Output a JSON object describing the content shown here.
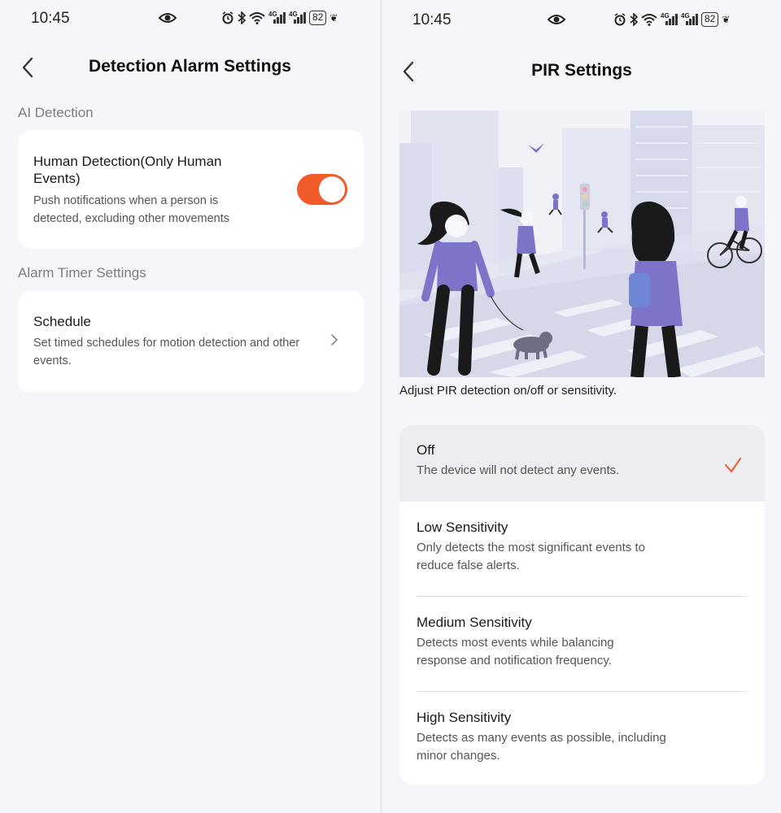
{
  "status_bar": {
    "time": "10:45",
    "network_label": "4G",
    "battery": "82"
  },
  "left_screen": {
    "title": "Detection Alarm Settings",
    "section_ai": "AI Detection",
    "human_detection": {
      "title": "Human Detection(Only Human Events)",
      "description": "Push notifications when a person is detected, excluding other movements",
      "enabled": true
    },
    "section_timer": "Alarm Timer Settings",
    "schedule": {
      "title": "Schedule",
      "description": "Set timed schedules for motion detection and other events."
    }
  },
  "right_screen": {
    "title": "PIR Settings",
    "caption": "Adjust PIR detection on/off or sensitivity.",
    "options": [
      {
        "title": "Off",
        "description": "The device will not detect any events.",
        "selected": true
      },
      {
        "title": "Low Sensitivity",
        "description": "Only detects the most significant events to reduce false alerts.",
        "selected": false
      },
      {
        "title": "Medium Sensitivity",
        "description": "Detects most events while balancing response and notification frequency.",
        "selected": false
      },
      {
        "title": "High Sensitivity",
        "description": "Detects as many events as possible, including minor changes.",
        "selected": false
      }
    ]
  },
  "colors": {
    "accent": "#f15a29",
    "background": "#f5f6f9",
    "card": "#ffffff",
    "selected_row": "#ecedf1",
    "illustration_purple": "#7b74c9"
  },
  "icons": [
    "eye-icon",
    "alarm-icon",
    "bluetooth-icon",
    "wifi-icon",
    "signal-icon",
    "battery-icon",
    "leaf-icon",
    "back-arrow-icon",
    "chevron-right-icon",
    "checkmark-icon"
  ]
}
